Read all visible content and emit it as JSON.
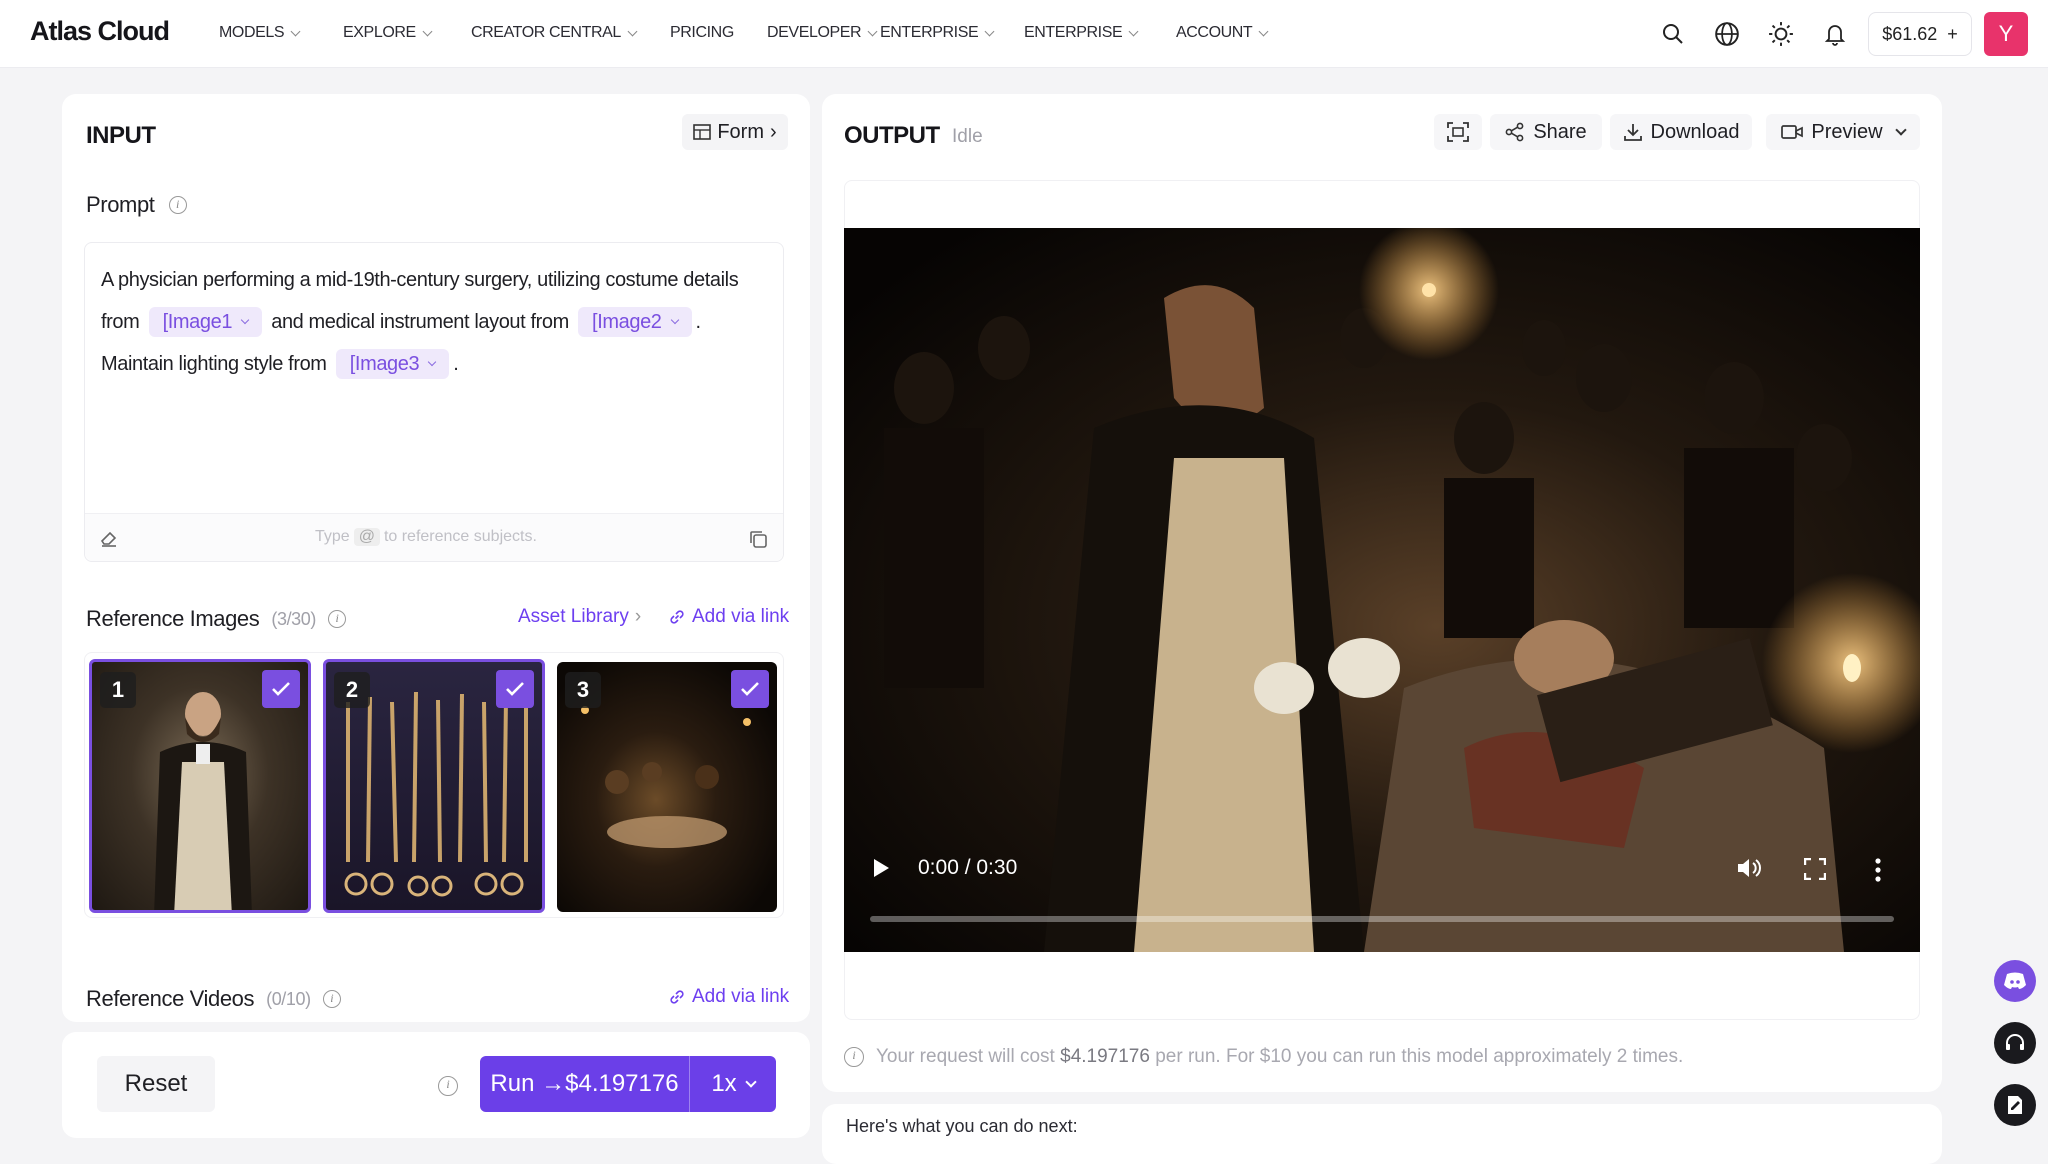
{
  "app": {
    "logo": "Atlas Cloud"
  },
  "nav": {
    "items": [
      "MODELS",
      "EXPLORE",
      "CREATOR CENTRAL",
      "PRICING",
      "DEVELOPER",
      "ENTERPRISE",
      "ENTERPRISE",
      "ACCOUNT"
    ]
  },
  "header": {
    "balance": "$61.62",
    "balance_add": "+",
    "avatar": "Y"
  },
  "input": {
    "title": "INPUT",
    "form_label": "Form",
    "prompt_label": "Prompt",
    "prompt": {
      "p1": "A physician performing a mid-19th-century surgery, utilizing costume details from",
      "chip1": "[Image1",
      "p2": "and medical instrument layout from",
      "chip2": "[Image2",
      "p3": ".",
      "p4": "Maintain lighting style from",
      "chip3": "[Image3",
      "p5": "."
    },
    "hint_before": "Type",
    "hint_at": "@",
    "hint_after": "to reference subjects.",
    "ref_images": {
      "label": "Reference Images",
      "count": "(3/30)",
      "asset_library": "Asset Library",
      "add_link": "Add via link",
      "items": [
        "1",
        "2",
        "3"
      ]
    },
    "ref_videos": {
      "label": "Reference Videos",
      "count": "(0/10)",
      "add_link": "Add via link"
    }
  },
  "actions": {
    "reset": "Reset",
    "run": "Run →$4.197176",
    "multiplier": "1x"
  },
  "output": {
    "title": "OUTPUT",
    "status": "Idle",
    "share": "Share",
    "download": "Download",
    "preview": "Preview",
    "video_time": "0:00 / 0:30",
    "cost_pre": "Your request will cost",
    "cost_value": "$4.197176",
    "cost_post": "per run. For $10 you can run this model approximately 2 times.",
    "next": "Here's what you can do next:"
  },
  "colors": {
    "accent": "#6b3fe8",
    "chip_bg": "#efe9fb",
    "avatar": "#e8336b"
  }
}
